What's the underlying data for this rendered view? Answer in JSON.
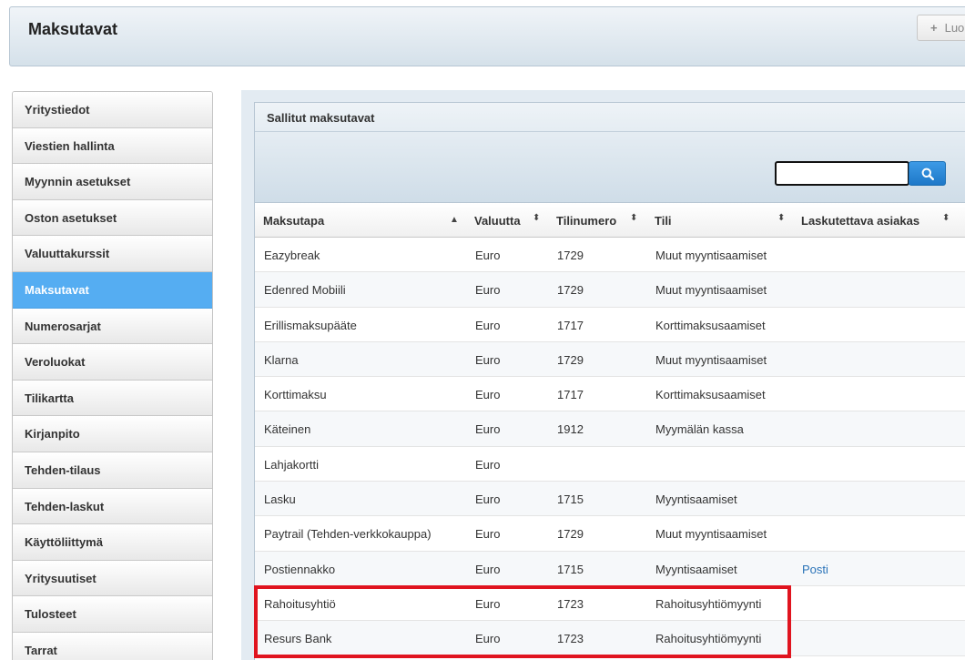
{
  "header": {
    "title": "Maksutavat",
    "add_button_label": "Luo"
  },
  "sidebar": {
    "items": [
      {
        "label": "Yritystiedot"
      },
      {
        "label": "Viestien hallinta"
      },
      {
        "label": "Myynnin asetukset"
      },
      {
        "label": "Oston asetukset"
      },
      {
        "label": "Valuuttakurssit"
      },
      {
        "label": "Maksutavat",
        "active": true
      },
      {
        "label": "Numerosarjat"
      },
      {
        "label": "Veroluokat"
      },
      {
        "label": "Tilikartta"
      },
      {
        "label": "Kirjanpito"
      },
      {
        "label": "Tehden-tilaus"
      },
      {
        "label": "Tehden-laskut"
      },
      {
        "label": "Käyttöliittymä"
      },
      {
        "label": "Yritysuutiset"
      },
      {
        "label": "Tulosteet"
      },
      {
        "label": "Tarrat"
      }
    ]
  },
  "panel": {
    "title": "Sallitut maksutavat",
    "search": {
      "value": "",
      "placeholder": ""
    }
  },
  "table": {
    "columns": [
      "Maksutapa",
      "Valuutta",
      "Tilinumero",
      "Tili",
      "Laskutettava asiakas"
    ],
    "rows": [
      [
        "Eazybreak",
        "Euro",
        "1729",
        "Muut myyntisaamiset",
        ""
      ],
      [
        "Edenred Mobiili",
        "Euro",
        "1729",
        "Muut myyntisaamiset",
        ""
      ],
      [
        "Erillismaksupääte",
        "Euro",
        "1717",
        "Korttimaksusaamiset",
        ""
      ],
      [
        "Klarna",
        "Euro",
        "1729",
        "Muut myyntisaamiset",
        ""
      ],
      [
        "Korttimaksu",
        "Euro",
        "1717",
        "Korttimaksusaamiset",
        ""
      ],
      [
        "Käteinen",
        "Euro",
        "1912",
        "Myymälän kassa",
        ""
      ],
      [
        "Lahjakortti",
        "Euro",
        "",
        "",
        ""
      ],
      [
        "Lasku",
        "Euro",
        "1715",
        "Myyntisaamiset",
        ""
      ],
      [
        "Paytrail (Tehden-verkkokauppa)",
        "Euro",
        "1729",
        "Muut myyntisaamiset",
        ""
      ],
      [
        "Postiennakko",
        "Euro",
        "1715",
        "Myyntisaamiset",
        "Posti"
      ],
      [
        "Rahoitusyhtiö",
        "Euro",
        "1723",
        "Rahoitusyhtiömyynti",
        ""
      ],
      [
        "Resurs Bank",
        "Euro",
        "1723",
        "Rahoitusyhtiömyynti",
        ""
      ]
    ]
  },
  "colors": {
    "accent": "#55adf2",
    "highlight": "#e0141f",
    "link": "#2a73b8"
  }
}
